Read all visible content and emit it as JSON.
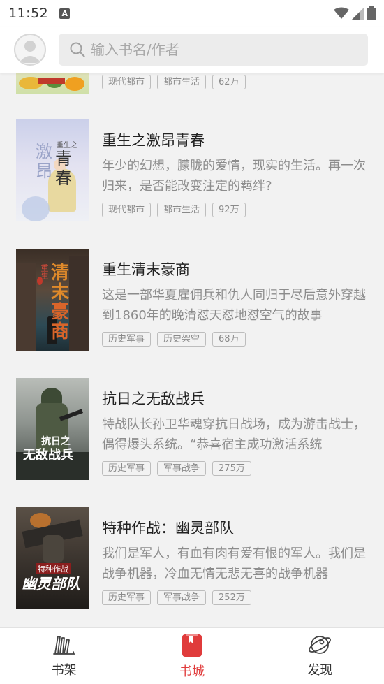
{
  "status_bar": {
    "time": "11:52",
    "notification_icon": "A"
  },
  "search": {
    "placeholder": "输入书名/作者"
  },
  "books": [
    {
      "title": "",
      "desc": "",
      "tags": [
        "现代都市",
        "都市生活",
        "62万"
      ]
    },
    {
      "title": "重生之激昂青春",
      "desc": "年少的幻想，朦胧的爱情，现实的生活。再一次归来，是否能改变注定的羁绊?",
      "tags": [
        "现代都市",
        "都市生活",
        "92万"
      ],
      "cover_text": [
        "激",
        "昂",
        "重生之",
        "青",
        "春"
      ]
    },
    {
      "title": "重生清末豪商",
      "desc": "这是一部华夏雇佣兵和仇人同归于尽后意外穿越到1860年的晚清怼天怼地怼空气的故事",
      "tags": [
        "历史军事",
        "历史架空",
        "68万"
      ],
      "cover_text": [
        "重生",
        "清",
        "末",
        "豪",
        "商"
      ]
    },
    {
      "title": "抗日之无敌战兵",
      "desc": "特战队长孙卫华魂穿抗日战场，成为游击战士，偶得爆头系统。“恭喜宿主成功激活系统",
      "tags": [
        "历史军事",
        "军事战争",
        "275万"
      ],
      "cover_text": [
        "抗日之",
        "无敌战兵"
      ]
    },
    {
      "title": "特种作战：幽灵部队",
      "desc": "我们是军人，有血有肉有爱有恨的军人。我们是战争机器，冷血无情无悲无喜的战争机器",
      "tags": [
        "历史军事",
        "军事战争",
        "252万"
      ],
      "cover_text": [
        "特种作战",
        "幽灵部队"
      ]
    }
  ],
  "tabbar": {
    "tabs": [
      {
        "label": "书架",
        "icon": "bookshelf-icon"
      },
      {
        "label": "书城",
        "icon": "bookstore-icon"
      },
      {
        "label": "发现",
        "icon": "planet-icon"
      }
    ],
    "active_color": "#e03b3b"
  }
}
